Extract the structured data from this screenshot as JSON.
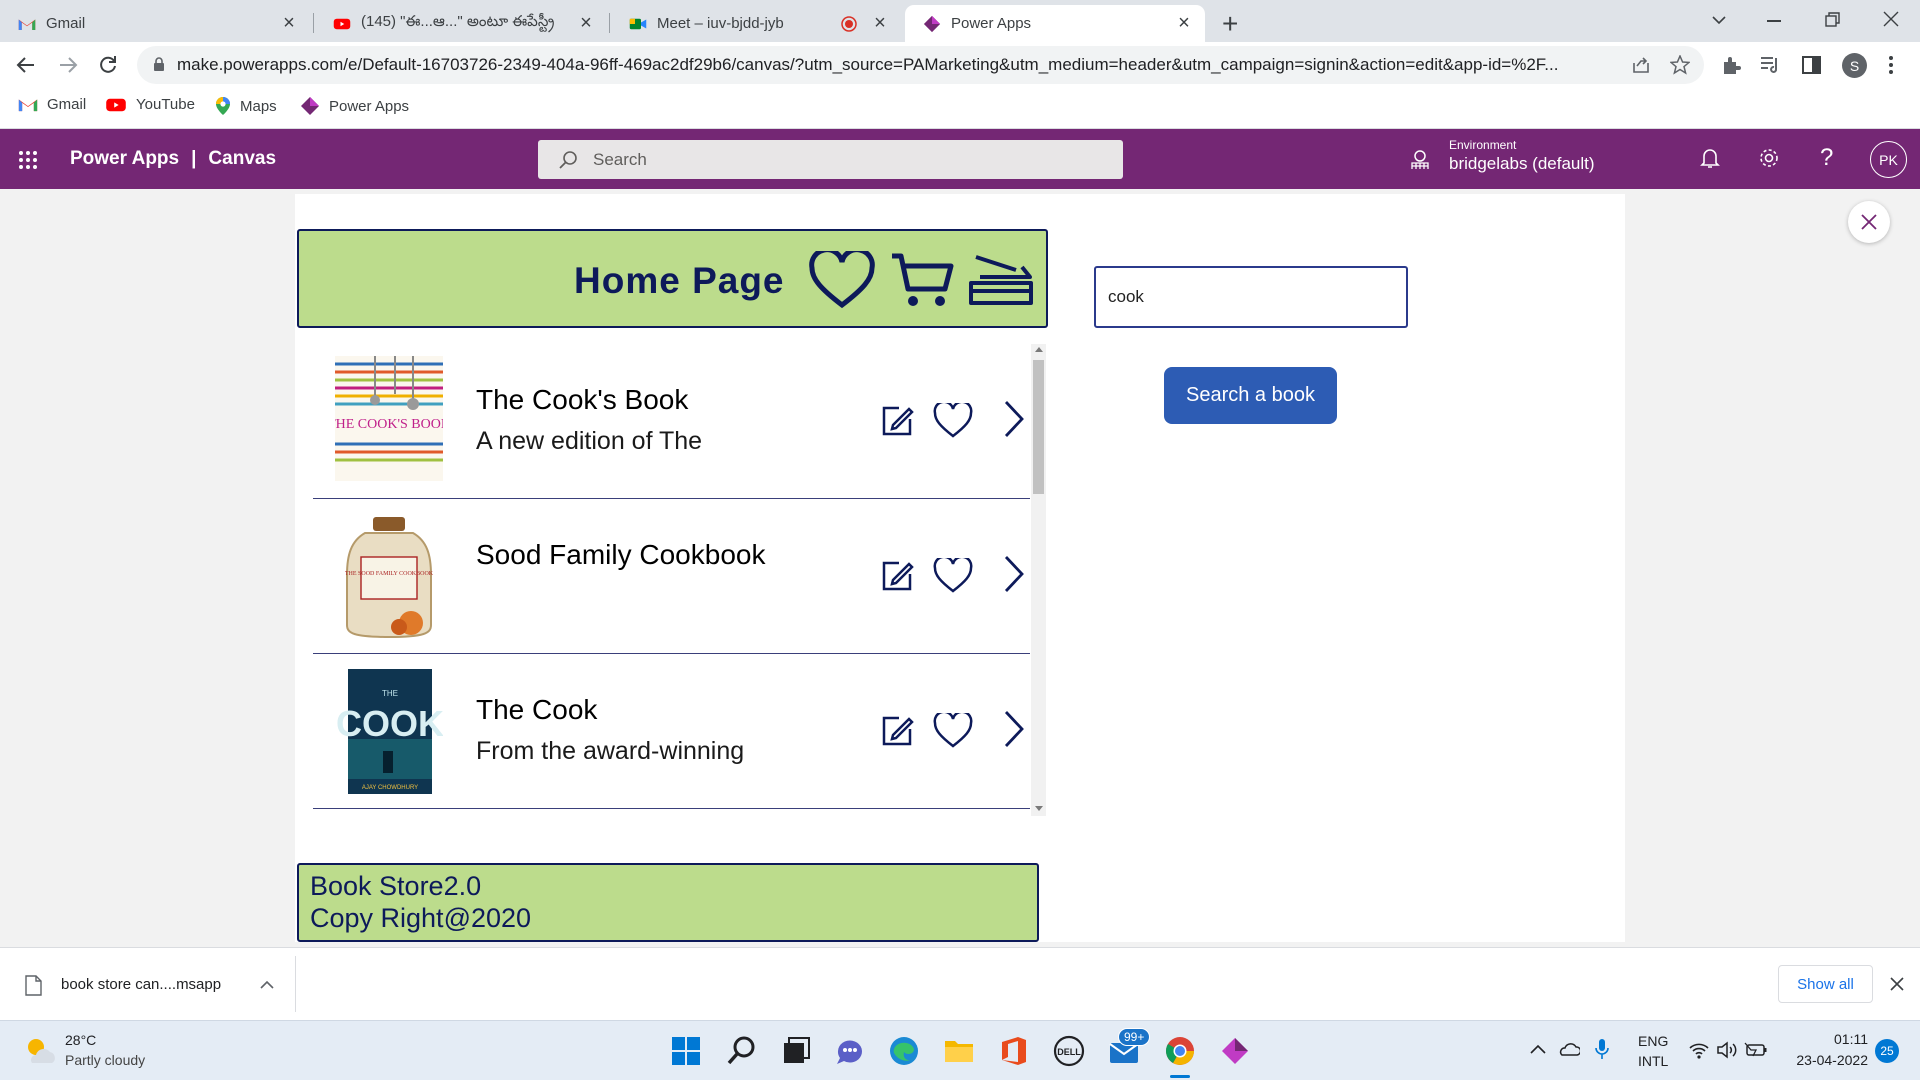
{
  "browser": {
    "tabs": [
      {
        "title": "Gmail",
        "icon": "gmail-icon"
      },
      {
        "title": "(145) \"ఈ...ఆ...\" అంటూ ఈపేస్ట్రీ",
        "icon": "youtube-icon"
      },
      {
        "title": "Meet – iuv-bjdd-jyb",
        "icon": "meet-icon"
      },
      {
        "title": "Power Apps",
        "icon": "powerapps-icon"
      }
    ],
    "url": "make.powerapps.com/e/Default-16703726-2349-404a-96ff-469ac2df29b6/canvas/?utm_source=PAMarketing&utm_medium=header&utm_campaign=signin&action=edit&app-id=%2F...",
    "profile_initial": "S",
    "bookmarks": [
      {
        "label": "Gmail",
        "icon": "gmail-icon"
      },
      {
        "label": "YouTube",
        "icon": "youtube-icon"
      },
      {
        "label": "Maps",
        "icon": "maps-icon"
      },
      {
        "label": "Power Apps",
        "icon": "powerapps-icon"
      }
    ]
  },
  "powerapps": {
    "brand": "Power Apps",
    "separator": "|",
    "section": "Canvas",
    "search_placeholder": "Search",
    "environment_label": "Environment",
    "environment_value": "bridgelabs (default)",
    "user_initials": "PK",
    "colors": {
      "header": "#742774",
      "bar": "#bcdc8c",
      "navy": "#0d1a5a",
      "button": "#2d5cb4"
    }
  },
  "app": {
    "home_title": "Home Page",
    "books": [
      {
        "title": "The Cook's Book",
        "subtitle": "A new edition of The",
        "cover": "THE COOK'S BOOK"
      },
      {
        "title": "Sood Family Cookbook",
        "subtitle": "",
        "cover": "THE SOOD FAMILY COOKBOOK"
      },
      {
        "title": "The Cook",
        "subtitle": "From the award-winning",
        "cover_top": "THE",
        "cover_main": "COOK",
        "cover_author": "AJAY CHOWDHURY"
      }
    ],
    "search_value": "cook",
    "search_button": "Search a book",
    "footer_line1": "Book Store2.0",
    "footer_line2": "Copy Right@2020"
  },
  "download": {
    "file": "book store can....msapp",
    "show_all": "Show all"
  },
  "taskbar": {
    "temperature": "28°C",
    "weather": "Partly cloudy",
    "mail_badge": "99+",
    "lang1": "ENG",
    "lang2": "INTL",
    "time": "01:11",
    "date": "23-04-2022",
    "notification_count": "25"
  }
}
